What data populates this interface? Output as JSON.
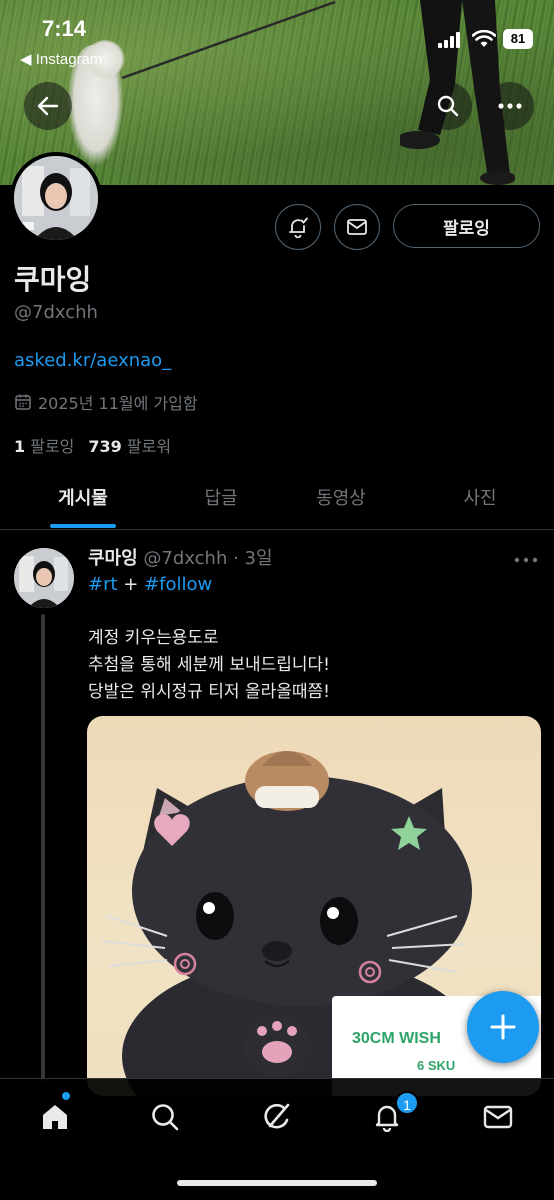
{
  "status_bar": {
    "time": "7:14",
    "back_app": "◀ Instagram",
    "battery": "81"
  },
  "profile": {
    "display_name": "쿠마잉",
    "handle": "@7dxchh",
    "link": "asked.kr/aexnao_",
    "joined": "2025년 11월에 가입함",
    "following_count": "1",
    "following_label": "팔로잉",
    "followers_count": "739",
    "followers_label": "팔로워",
    "follow_button": "팔로잉"
  },
  "tabs": [
    {
      "label": "게시물",
      "active": true
    },
    {
      "label": "답글",
      "active": false
    },
    {
      "label": "동영상",
      "active": false
    },
    {
      "label": "사진",
      "active": false
    }
  ],
  "post": {
    "author_name": "쿠마잉",
    "author_handle": "@7dxchh",
    "separator": " · ",
    "time": "3일",
    "hashtag_1": "#rt",
    "plus": " + ",
    "hashtag_2": "#follow",
    "lines": [
      "계정 키우는용도로",
      "추첨을 통해 세분께 보내드립니다!",
      "당발은 위시정규 티저 올라올때쯤!"
    ],
    "media_label_line1": "30CM WISH",
    "media_label_line2": "6 SKU"
  },
  "nav": {
    "notification_badge": "1"
  },
  "icons": {
    "back": "arrow-left-icon",
    "search": "search-icon",
    "more": "more-horizontal-icon",
    "notify": "bell-plus-icon",
    "message": "envelope-icon",
    "calendar": "calendar-icon",
    "compose": "plus-icon",
    "home": "home-icon",
    "grok": "grok-icon",
    "bell": "bell-icon",
    "mail": "mail-icon"
  },
  "colors": {
    "accent": "#1d9bf0",
    "background": "#000000",
    "text_primary": "#e7e9ea",
    "text_secondary": "#71767b"
  }
}
